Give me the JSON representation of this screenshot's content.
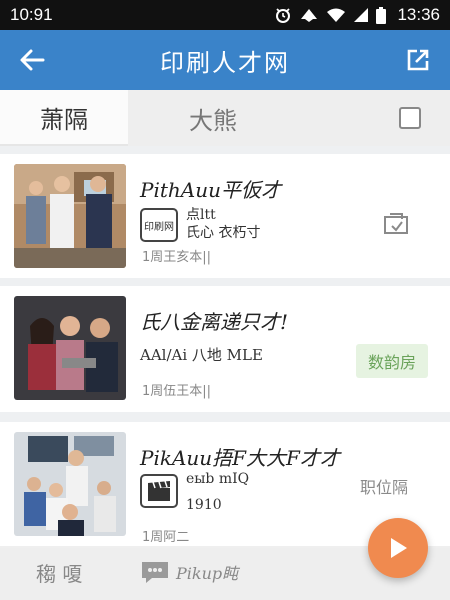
{
  "status_bar": {
    "time_left": "10:91",
    "time_right": "13:36"
  },
  "app_bar": {
    "title": "印刷人才网"
  },
  "tabs": {
    "active": "萧隔",
    "inactive": "大熊"
  },
  "listings": [
    {
      "title": "PithAuu平仮才",
      "logo_label": "印刷网",
      "logo_text_1": "点ltt",
      "logo_text_2": "氏心 衣朽寸",
      "meta": "1周王亥本||",
      "tag": ""
    },
    {
      "title": "氏八金离递只才!",
      "subtitle": "AAl/Ai 八地 MLE",
      "meta": "1周伍王本||",
      "tag": "数韵房"
    },
    {
      "title": "PikAuu捂F大大F才才",
      "logo_text_1": "eыb mIQ",
      "logo_text_2": "1910",
      "meta": "1周阿二",
      "tag": "职位隔"
    }
  ],
  "bottom_bar": {
    "item1": "䅳 嗄",
    "item2": "Pikup盹"
  },
  "colors": {
    "app_bar": "#3a83c9",
    "fab": "#f08a4f",
    "tag_green_bg": "#e6f3e1",
    "tag_green_text": "#6aa35a"
  },
  "icons": [
    "back-arrow-icon",
    "share-icon",
    "checkbox-icon",
    "bookmark-icon",
    "play-icon",
    "chat-icon",
    "alarm-icon",
    "wifi-icon",
    "signal-icon",
    "battery-icon"
  ]
}
